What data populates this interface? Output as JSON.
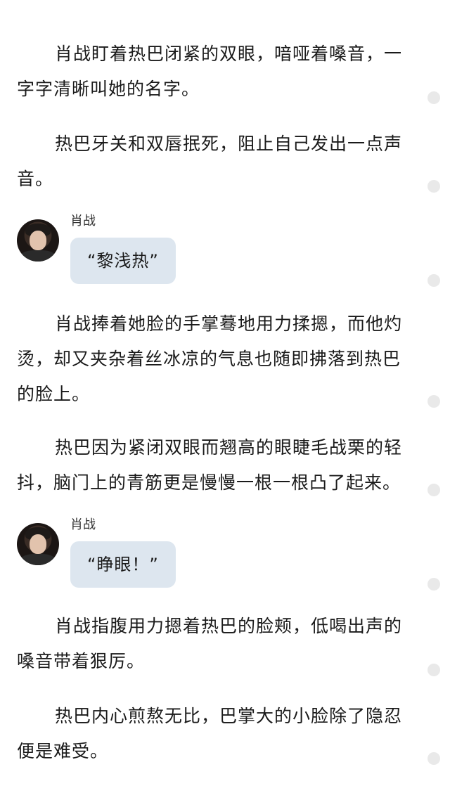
{
  "paragraphs": [
    "肖战盯着热巴闭紧的双眼，喑哑着嗓音，一字字清晰叫她的名字。",
    "热巴牙关和双唇抿死，阻止自己发出一点声音。",
    "肖战捧着她脸的手掌蓦地用力揉摁，而他灼烫，却又夹杂着丝冰凉的气息也随即拂落到热巴的脸上。",
    "热巴因为紧闭双眼而翘高的眼睫毛战栗的轻抖，脑门上的青筋更是慢慢一根一根凸了起来。",
    "肖战指腹用力摁着热巴的脸颊，低喝出声的嗓音带着狠厉。",
    "热巴内心煎熬无比，巴掌大的小脸除了隐忍便是难受。"
  ],
  "messages": [
    {
      "sender": "肖战",
      "text": "“黎浅热”"
    },
    {
      "sender": "肖战",
      "text": "“睁眼！”"
    }
  ],
  "side_icons": [
    "page-dot-icon"
  ],
  "colors": {
    "bubble": "#dde6ef",
    "text": "#1a1a1a",
    "dot": "#e9e9e9"
  }
}
